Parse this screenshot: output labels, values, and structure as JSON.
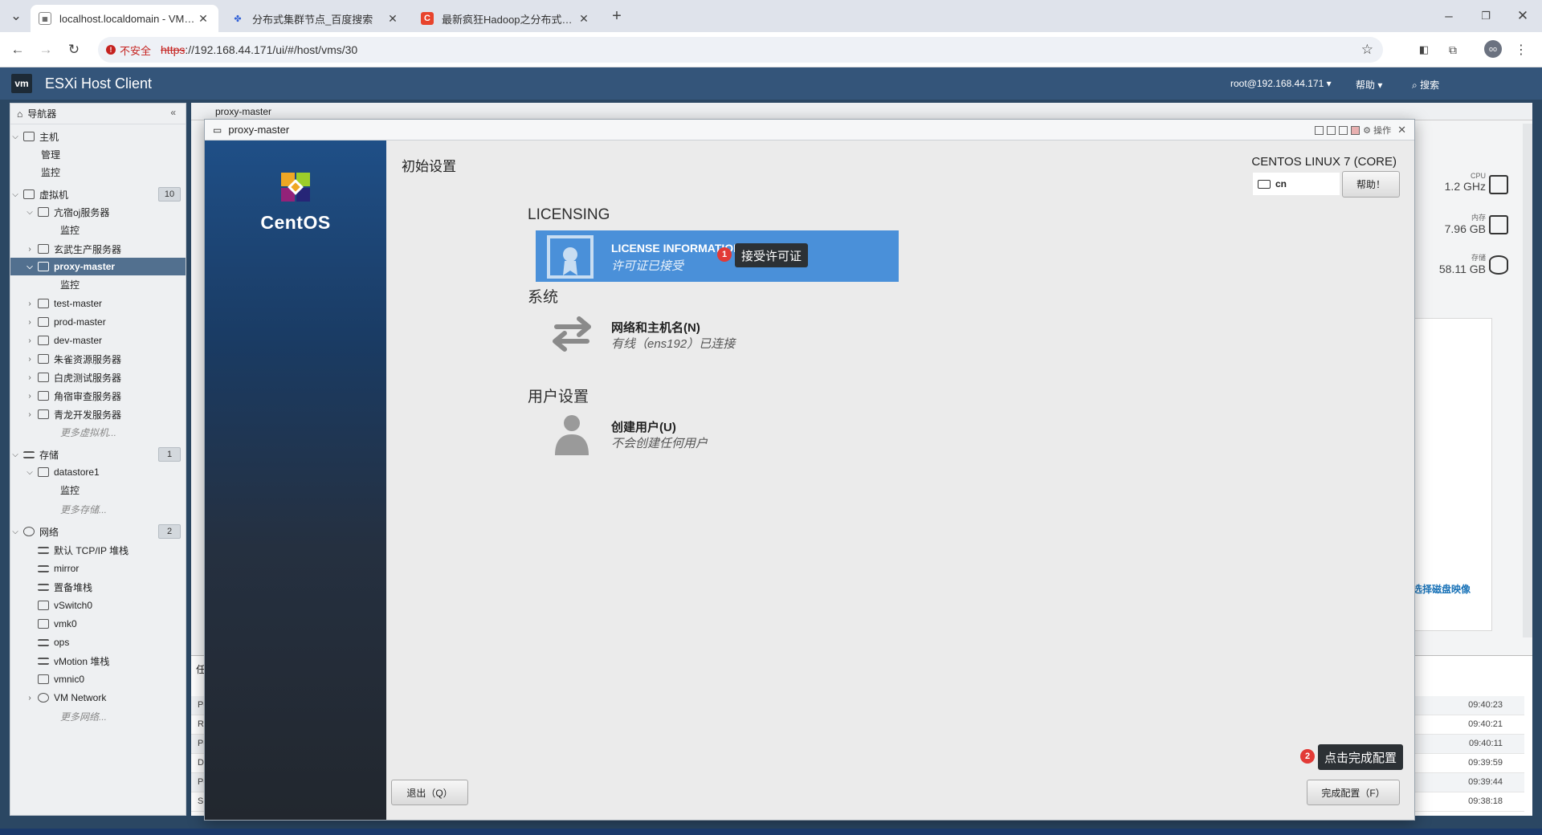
{
  "browser": {
    "tabs": [
      {
        "title": "localhost.localdomain - VMware ESXi",
        "active": true
      },
      {
        "title": "分布式集群节点_百度搜索",
        "active": false
      },
      {
        "title": "最新疯狂Hadoop之分布式集群",
        "active": false
      }
    ],
    "security_label": "不安全",
    "url_scheme": "https",
    "url_rest": "://192.168.44.171/ui/#/host/vms/30",
    "profile_initials": "oo"
  },
  "esxi": {
    "logo": "vm",
    "title": "ESXi Host Client",
    "user": "root@192.168.44.171",
    "help": "帮助",
    "search": "搜索"
  },
  "navigator": {
    "title": "导航器",
    "host": "主机",
    "host_children": [
      "管理",
      "监控"
    ],
    "vms_label": "虚拟机",
    "vms_count": "10",
    "vms": [
      {
        "name": "亢宿oj服务器",
        "expanded": true,
        "child": "监控"
      },
      {
        "name": "玄武生产服务器"
      },
      {
        "name": "proxy-master",
        "selected": true,
        "expanded": true,
        "child": "监控"
      },
      {
        "name": "test-master"
      },
      {
        "name": "prod-master"
      },
      {
        "name": "dev-master"
      },
      {
        "name": "朱雀资源服务器"
      },
      {
        "name": "白虎测试服务器"
      },
      {
        "name": "角宿审查服务器"
      },
      {
        "name": "青龙开发服务器"
      }
    ],
    "vms_more": "更多虚拟机...",
    "storage_label": "存储",
    "storage_count": "1",
    "datastore": "datastore1",
    "datastore_child": "监控",
    "storage_more": "更多存储...",
    "network_label": "网络",
    "network_count": "2",
    "networks": [
      "默认 TCP/IP 堆栈",
      "mirror",
      "置备堆栈",
      "vSwitch0",
      "vmk0",
      "ops",
      "vMotion 堆栈",
      "vmnic0",
      "VM Network"
    ],
    "network_more": "更多网络..."
  },
  "background_page": {
    "tab_label": "proxy-master",
    "stats": [
      {
        "label": "CPU",
        "value": "1.2 GHz"
      },
      {
        "label": "内存",
        "value": "7.96 GB"
      },
      {
        "label": "存储",
        "value": "58.11 GB"
      }
    ],
    "disk_link": "选择磁盘映像",
    "task_times": [
      "09:40:23",
      "09:40:21",
      "09:40:11",
      "09:39:59",
      "09:39:44",
      "09:38:18"
    ],
    "task_col_initials": [
      "Pc",
      "Re",
      "Pc",
      "De",
      "Pc",
      "Sh"
    ],
    "task_header": "任"
  },
  "console": {
    "title": "proxy-master",
    "actions": "操作",
    "brand": "CentOS",
    "page_title": "初始设置",
    "product": "CENTOS LINUX 7 (CORE)",
    "keyboard": "cn",
    "help_button": "帮助！",
    "sections": {
      "licensing": "LICENSING",
      "system": "系统",
      "user": "用户设置"
    },
    "license_title": "LICENSE INFORMATION",
    "license_status": "许可证已接受",
    "network_title": "网络和主机名(N)",
    "network_status": "有线（ens192）已连接",
    "user_title": "创建用户(U)",
    "user_status": "不会创建任何用户",
    "quit_button": "退出（Q）",
    "finish_button": "完成配置（F）"
  },
  "annotations": [
    {
      "number": "1",
      "text": "接受许可证"
    },
    {
      "number": "2",
      "text": "点击完成配置"
    }
  ],
  "colors": {
    "esxi_header": "#34557a",
    "selected_nav": "#52708f",
    "license_highlight": "#4a90d9",
    "annotation_marker": "#e23a36"
  }
}
